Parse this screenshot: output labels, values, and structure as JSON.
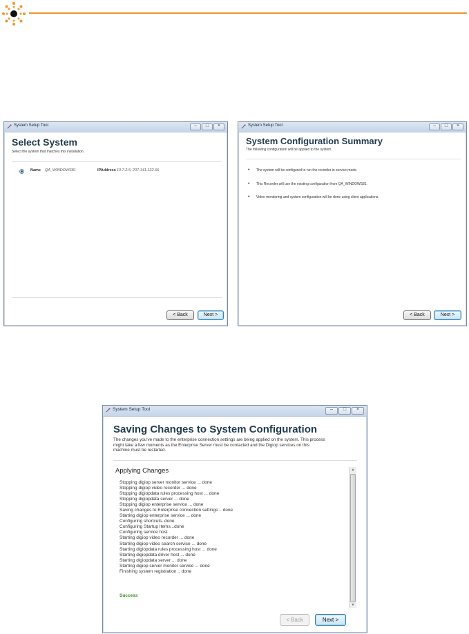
{
  "colors": {
    "accent": "#f0962c",
    "heading": "#1f3a4d",
    "success": "#2e8b1a"
  },
  "icons": {
    "logo": "orange-dotted-sun-icon",
    "app": "setup-tool-icon"
  },
  "window_controls": {
    "minimize": "–",
    "maximize": "□",
    "close": "×"
  },
  "select_system": {
    "title_bar": "System Setup Tool",
    "heading": "Select System",
    "subtitle": "Select the system that matches this installation.",
    "row": {
      "name_label": "Name",
      "name_value": "QA_WINDOWS81",
      "ip_label": "IPAddress",
      "ip_value": "10.7.2.5; 207.141.122.66"
    },
    "back_label": "< Back",
    "next_label": "Next >"
  },
  "summary": {
    "title_bar": "System Setup Tool",
    "heading": "System Configuration Summary",
    "subtitle": "The following configuration will be applied to the system.",
    "bullets": [
      "The system will be configured to run the recorder in service mode.",
      "This Recorder will use the existing configuration from QA_WINDOWS81.",
      "Video monitoring and system configuration will be done using client applications."
    ],
    "back_label": "< Back",
    "next_label": "Next >"
  },
  "saving": {
    "title_bar": "System Setup Tool",
    "heading": "Saving Changes to System Configuration",
    "description": [
      "The changes you've made to the enterprise connection settings are being applied on the system. This process",
      "might take a few moments as the Enterprise Server must be contacted and the Digiop services on this",
      "machine must be restarted."
    ],
    "section_title": "Applying Changes",
    "log": [
      "Stopping digiop server monitor service ... done",
      "Stopping digiop video recorder ... done",
      "Stopping digiopdata rules processing host ... done",
      "Stopping digiopdata server ... done",
      "Stopping digiop enterprise service ... done",
      "Saving changes to Enterprise connection settings .. done",
      "Starting digiop enterprise service ... done",
      "Configuring shortcuts..done",
      "Configuring Startup Items...done",
      "Configuring service host",
      "Starting digiop video recorder ... done",
      "Starting digiop video search service ... done",
      "Starting digiopdata rules processing host ... done",
      "Starting digiopdata driver host ... done",
      "Starting digiopdata server ... done",
      "Starting digiop server monitor service ... done",
      "Finishing system registration .. done"
    ],
    "status": "Success",
    "back_label": "< Back",
    "next_label": "Next >"
  }
}
